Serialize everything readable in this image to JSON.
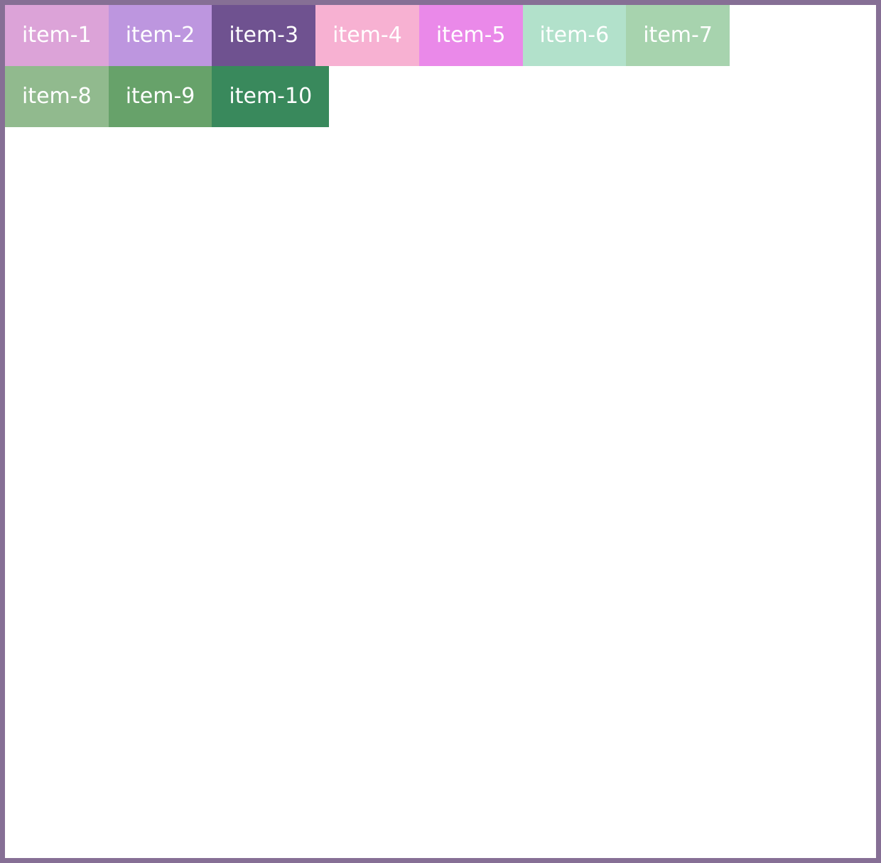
{
  "items": [
    {
      "label": "item-1",
      "color": "#dca3d8"
    },
    {
      "label": "item-2",
      "color": "#bd96df"
    },
    {
      "label": "item-3",
      "color": "#6f5290"
    },
    {
      "label": "item-4",
      "color": "#f7b1d2"
    },
    {
      "label": "item-5",
      "color": "#ea89e9"
    },
    {
      "label": "item-6",
      "color": "#b2e1cb"
    },
    {
      "label": "item-7",
      "color": "#a7d3ae"
    },
    {
      "label": "item-8",
      "color": "#91ba8e"
    },
    {
      "label": "item-9",
      "color": "#67a26a"
    },
    {
      "label": "item-10",
      "color": "#39895c"
    }
  ],
  "frame": {
    "border_color": "#866f95",
    "background": "#ffffff"
  }
}
